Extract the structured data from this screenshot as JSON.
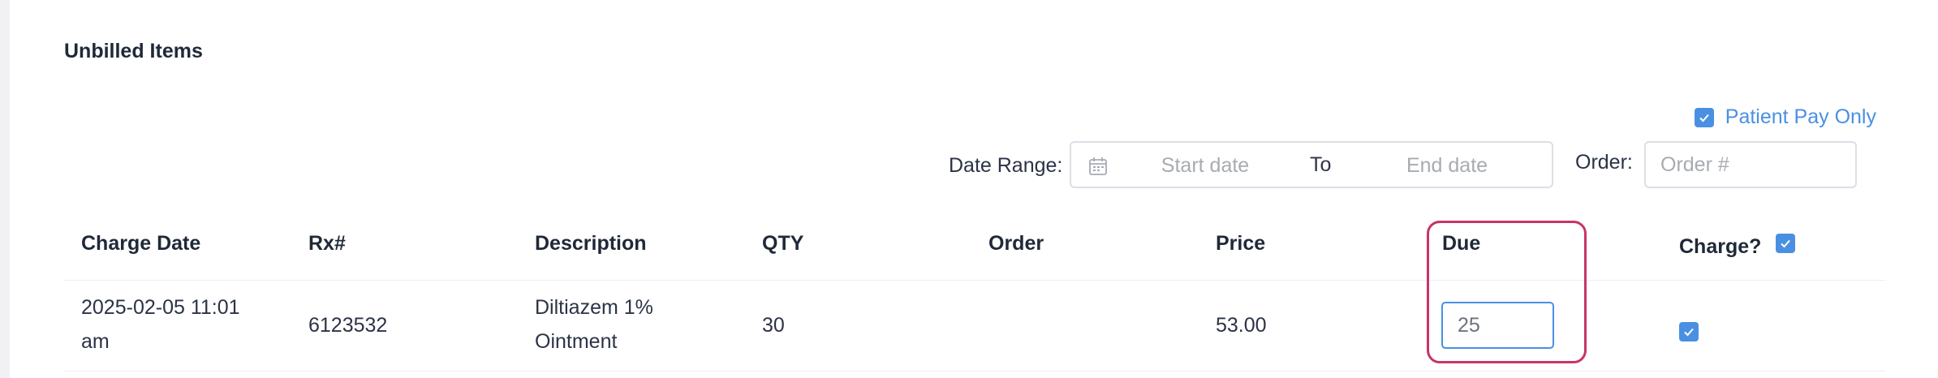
{
  "section": {
    "title": "Unbilled Items"
  },
  "filters": {
    "patient_pay_only": {
      "label": "Patient Pay Only",
      "checked": true
    },
    "date_range_label": "Date Range:",
    "start_date_placeholder": "Start date",
    "to_label": "To",
    "end_date_placeholder": "End date",
    "order_label": "Order:",
    "order_placeholder": "Order #"
  },
  "table": {
    "columns": [
      "Charge Date",
      "Rx#",
      "Description",
      "QTY",
      "Order",
      "Price",
      "Due",
      "Charge?"
    ],
    "charge_all_checked": true,
    "rows": [
      {
        "charge_date_line1": "2025-02-05 11:01",
        "charge_date_line2": "am",
        "rx": "6123532",
        "description_line1": "Diltiazem 1%",
        "description_line2": "Ointment",
        "qty": "30",
        "order": "",
        "price": "53.00",
        "due": "25",
        "charge": true
      }
    ]
  },
  "colors": {
    "accent": "#4a90e2",
    "highlight": "#c8336a"
  }
}
